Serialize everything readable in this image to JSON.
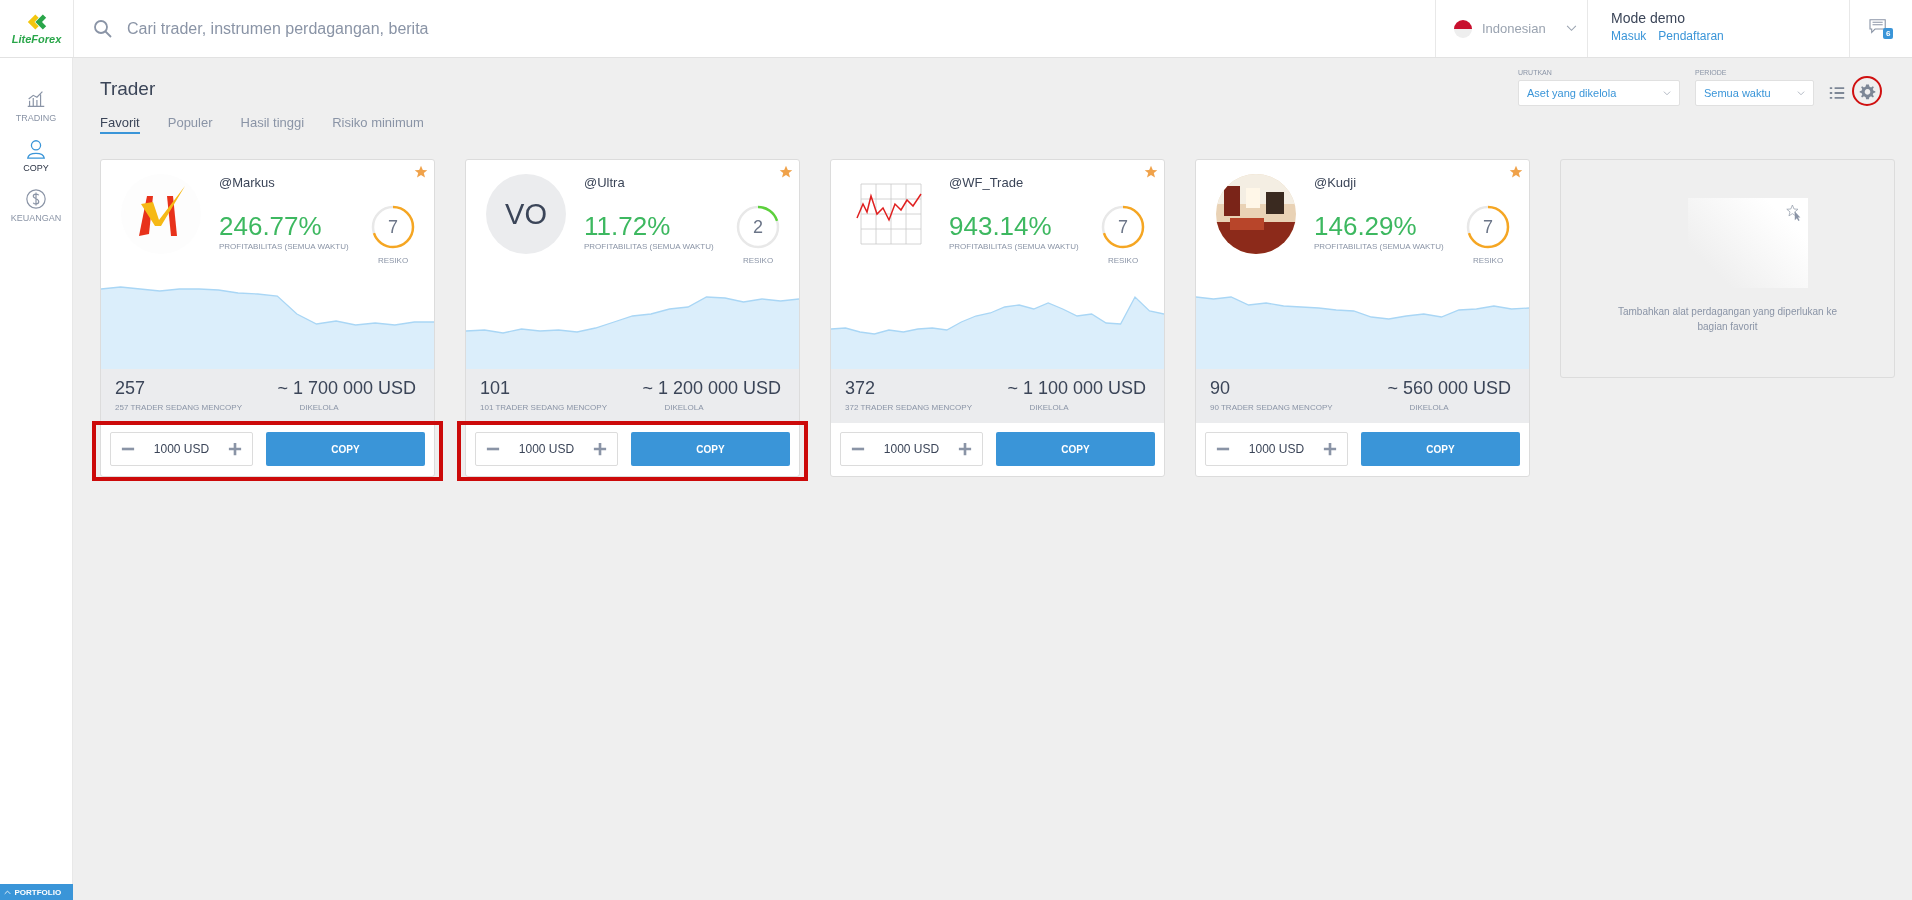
{
  "header": {
    "logo": "LiteForex",
    "search": {
      "placeholder": "Cari trader, instrumen perdagangan, berita"
    },
    "language": "Indonesian",
    "mode": "Mode demo",
    "links": [
      "Masuk",
      "Pendaftaran"
    ],
    "messages_badge": "6"
  },
  "sidebar": {
    "items": [
      {
        "label": "TRADING",
        "selected": false
      },
      {
        "label": "COPY",
        "selected": true
      },
      {
        "label": "KEUANGAN",
        "selected": false
      }
    ],
    "portfolio": "PORTFOLIO"
  },
  "page": {
    "title": "Trader",
    "tabs": [
      {
        "label": "Favorit",
        "selected": true
      },
      {
        "label": "Populer",
        "selected": false
      },
      {
        "label": "Hasil tinggi",
        "selected": false
      },
      {
        "label": "Risiko minimum",
        "selected": false
      }
    ],
    "sort": {
      "label": "URUTKAN",
      "value": "Aset yang dikelola"
    },
    "period": {
      "label": "PERIODE",
      "value": "Semua waktu"
    },
    "settings_highlighted": true
  },
  "traders": [
    {
      "name": "@Markus",
      "profit": "246.77%",
      "profit_label": "PROFITABILITAS (SEMUA WAKTU)",
      "risk": "7",
      "risk_label": "RESIKO",
      "level": 0.7,
      "color": "#f5a623",
      "favorite": true,
      "copiers": "257",
      "copiers_label": "257 TRADER SEDANG MENCOPY",
      "managed": "~ 1 700 000 USD",
      "managed_label": "DIKELOLA",
      "amount": "1000 USD",
      "button": "COPY",
      "highlighted": true
    },
    {
      "name": "@Ultra",
      "avatar": {
        "kind": "initials",
        "text": "VO"
      },
      "profit": "11.72%",
      "profit_label": "PROFITABILITAS (SEMUA WAKTU)",
      "risk": "2",
      "risk_label": "RESIKO",
      "level": 0.2,
      "color": "#5cd03c",
      "favorite": true,
      "copiers": "101",
      "copiers_label": "101 TRADER SEDANG MENCOPY",
      "managed": "~ 1 200 000 USD",
      "managed_label": "DIKELOLA",
      "amount": "1000 USD",
      "button": "COPY",
      "highlighted": true
    },
    {
      "name": "@WF_Trade",
      "profit": "943.14%",
      "profit_label": "PROFITABILITAS (SEMUA WAKTU)",
      "risk": "7",
      "risk_label": "RESIKO",
      "level": 0.7,
      "color": "#f5a623",
      "favorite": true,
      "copiers": "372",
      "copiers_label": "372 TRADER SEDANG MENCOPY",
      "managed": "~ 1 100 000 USD",
      "managed_label": "DIKELOLA",
      "amount": "1000 USD",
      "button": "COPY",
      "highlighted": false
    },
    {
      "name": "@Kudji",
      "profit": "146.29%",
      "profit_label": "PROFITABILITAS (SEMUA WAKTU)",
      "risk": "7",
      "risk_label": "RESIKO",
      "level": 0.7,
      "color": "#f5a623",
      "favorite": true,
      "copiers": "90",
      "copiers_label": "90 TRADER SEDANG MENCOPY",
      "managed": "~ 560 000 USD",
      "managed_label": "DIKELOLA",
      "amount": "1000 USD",
      "button": "COPY",
      "highlighted": false
    }
  ],
  "empty_card": {
    "text": "Tambahkan alat perdagangan yang diperlukan ke bagian favorit"
  }
}
